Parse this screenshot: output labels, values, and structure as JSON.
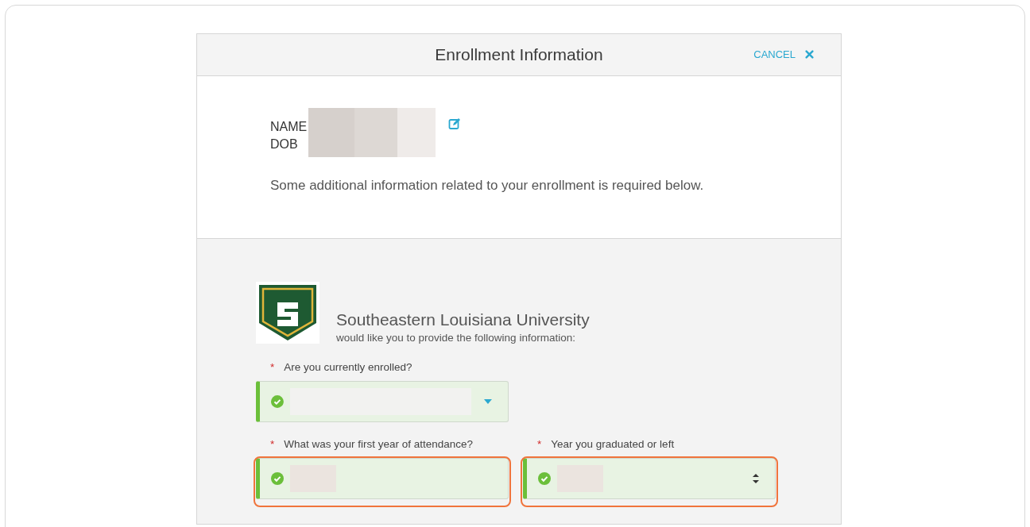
{
  "dialog": {
    "title": "Enrollment Information",
    "cancel_label": "CANCEL"
  },
  "person": {
    "name_label": "NAME",
    "dob_label": "DOB"
  },
  "intro": "Some additional information related to your enrollment is required below.",
  "school": {
    "name": "Southeastern Louisiana University",
    "subtitle": "would like you to provide the following information:"
  },
  "fields": [
    {
      "label": "Are you currently enrolled?",
      "required_mark": "*",
      "kind": "dropdown",
      "valid": true,
      "highlighted": false
    },
    {
      "label": "What was your first year of attendance?",
      "required_mark": "*",
      "kind": "text",
      "valid": true,
      "highlighted": true
    },
    {
      "label": "Year you graduated or left",
      "required_mark": "*",
      "kind": "number",
      "valid": true,
      "highlighted": true
    }
  ]
}
